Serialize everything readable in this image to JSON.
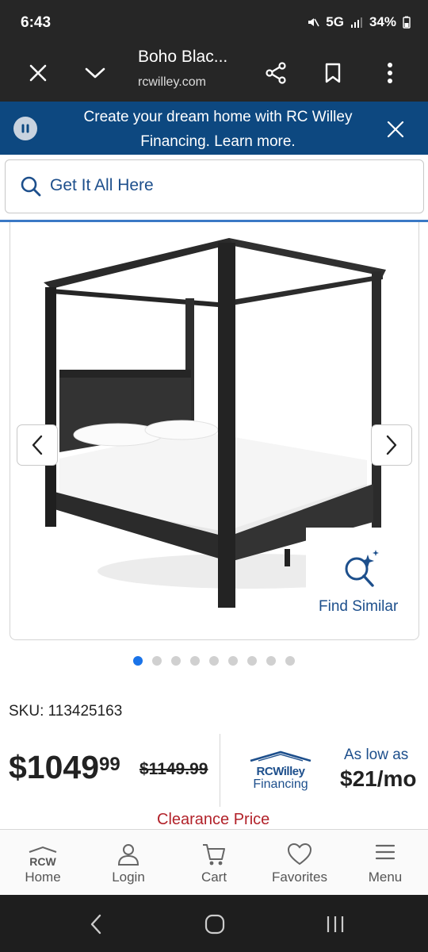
{
  "status": {
    "time": "6:43",
    "network": "5G",
    "battery": "34%"
  },
  "browser": {
    "title": "Boho Blac...",
    "url": "rcwilley.com"
  },
  "banner": {
    "text": "Create your dream home with RC Willey Financing. Learn more."
  },
  "search": {
    "placeholder": "Get It All Here"
  },
  "gallery": {
    "find_similar": "Find Similar",
    "slide_count": 9,
    "active_slide": 1
  },
  "product": {
    "sku_label": "SKU: 113425163",
    "price_dollars": "$1049",
    "price_cents": "99",
    "old_price": "$1149.99",
    "financing_brand": "RCWilley",
    "financing_label": "Financing",
    "as_low_as": "As low as",
    "monthly": "$21/mo",
    "clearance": "Clearance Price"
  },
  "bottom_nav": {
    "home": "Home",
    "home_logo": "RCW",
    "login": "Login",
    "cart": "Cart",
    "favorites": "Favorites",
    "menu": "Menu"
  },
  "colors": {
    "brand_blue": "#0d4880",
    "link_blue": "#1d4f8c",
    "clearance_red": "#b2222a",
    "dot_active": "#1a73e8"
  }
}
